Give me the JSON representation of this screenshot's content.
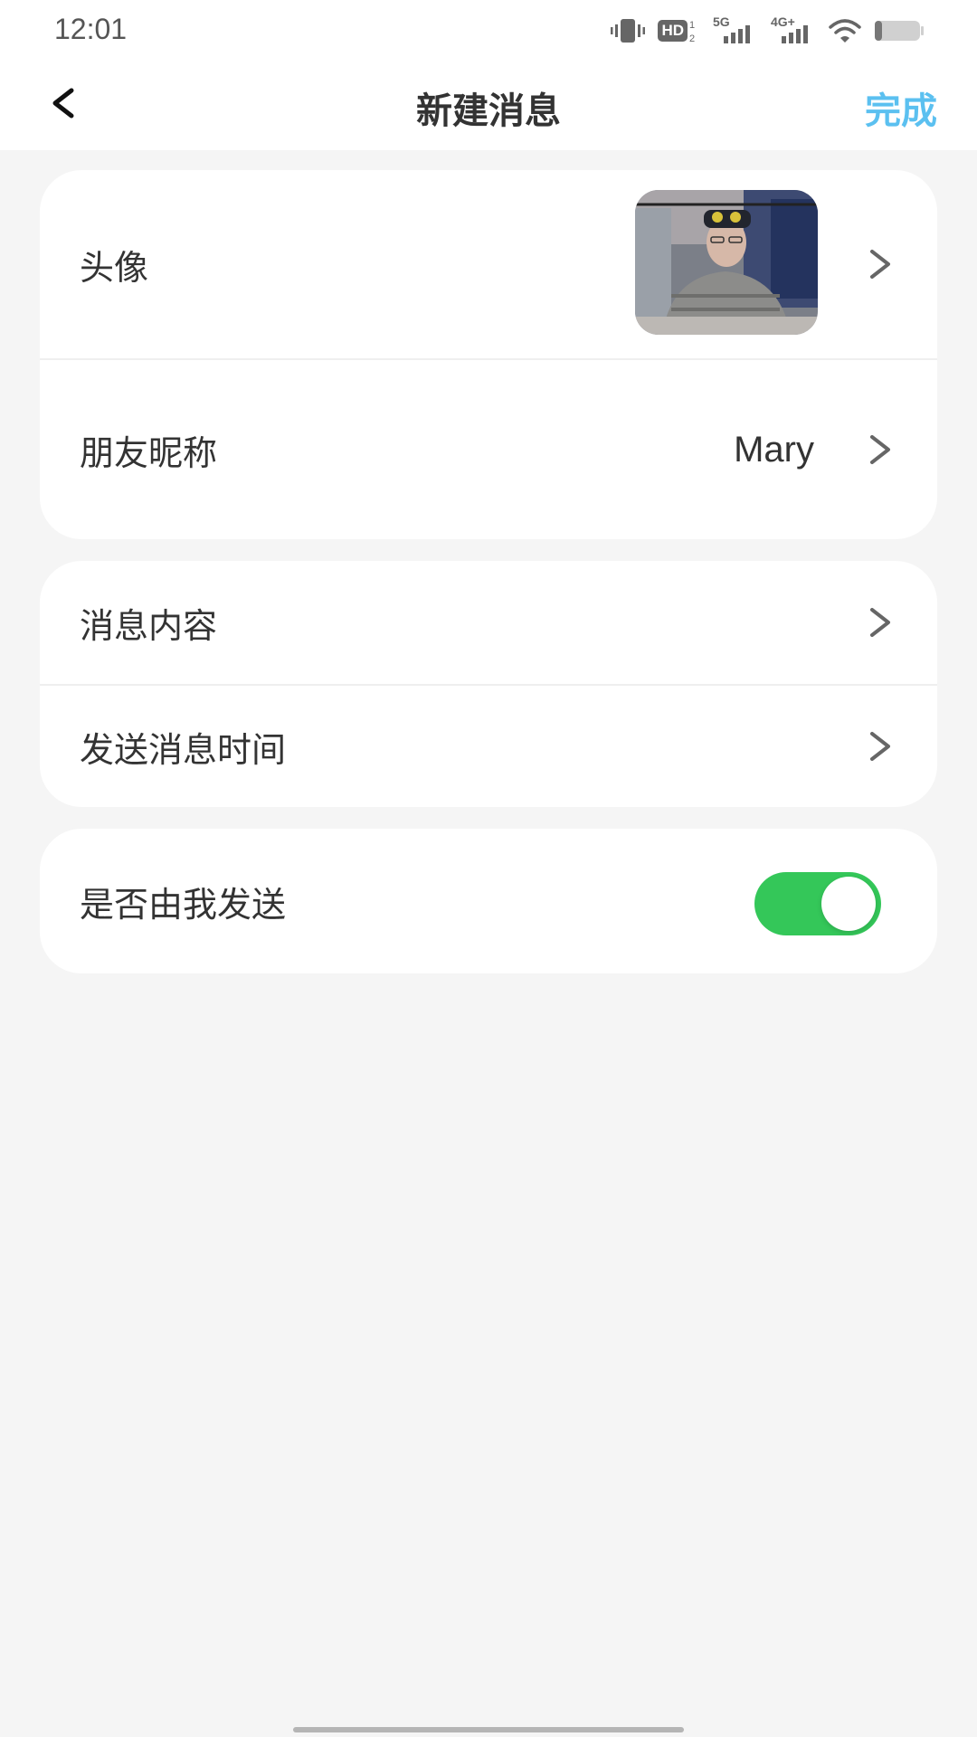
{
  "status_bar": {
    "time": "12:01",
    "icons": [
      "vibrate-icon",
      "hd-icon",
      "signal-5g-icon",
      "signal-4g-icon",
      "wifi-icon",
      "battery-icon"
    ],
    "hd_label": "HD",
    "network_5g": "5G",
    "network_4g": "4G+"
  },
  "nav": {
    "back_icon": "chevron-left-icon",
    "title": "新建消息",
    "done_label": "完成"
  },
  "colors": {
    "accent_done": "#5bc0f0",
    "toggle_on": "#34c759",
    "background": "#f5f5f5"
  },
  "profile_card": {
    "avatar_label": "头像",
    "nickname_label": "朋友昵称",
    "nickname_value": "Mary"
  },
  "message_card": {
    "content_label": "消息内容",
    "send_time_label": "发送消息时间"
  },
  "sender_card": {
    "sent_by_me_label": "是否由我发送",
    "sent_by_me": true
  }
}
